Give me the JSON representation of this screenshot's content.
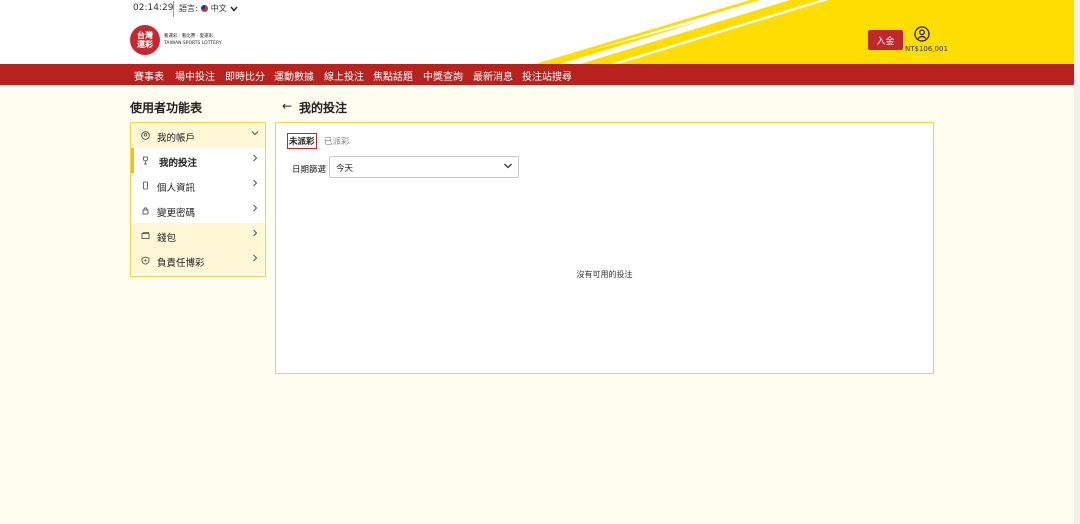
{
  "header": {
    "time": "02:14:29",
    "language_label": "語言:",
    "language_value": "中文",
    "logo_text": "台灣運彩",
    "logo_subtitle_1": "看運彩 · 看比賽 · 愛運彩",
    "logo_subtitle_2": "TAIWAN SPORTS LOTTERY",
    "deposit_label": "入金",
    "balance": "NT$106,001"
  },
  "nav": {
    "items": [
      "賽事表",
      "場中投注",
      "即時比分",
      "運動數據",
      "線上投注",
      "焦點話題",
      "中獎查詢",
      "最新消息",
      "投注站搜尋"
    ]
  },
  "sidebar": {
    "title": "使用者功能表",
    "items": [
      {
        "label": "我的帳戶",
        "icon": "user-icon"
      },
      {
        "label": "我的投注",
        "icon": "trophy-icon"
      },
      {
        "label": "個人資訊",
        "icon": "phone-icon"
      },
      {
        "label": "變更密碼",
        "icon": "lock-icon"
      },
      {
        "label": "錢包",
        "icon": "wallet-icon"
      },
      {
        "label": "負責任博彩",
        "icon": "shield-icon"
      }
    ]
  },
  "main": {
    "back_icon": "back-arrow-icon",
    "title": "我的投注",
    "tabs": [
      "未派彩",
      "已派彩"
    ],
    "filter_label": "日期篩選",
    "filter_value": "今天",
    "empty_message": "沒有可用的投注"
  },
  "colors": {
    "brand_red": "#b7221f",
    "accent_yellow": "#f2d44a",
    "page_bg": "#fffcf0"
  }
}
